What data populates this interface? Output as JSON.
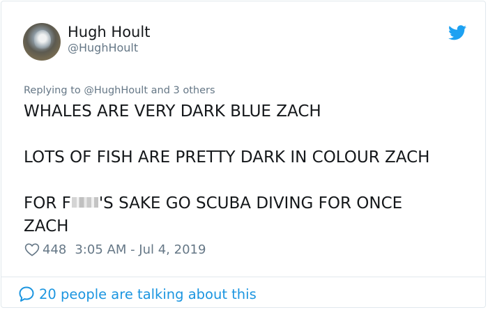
{
  "author": {
    "display_name": "Hugh Hoult",
    "handle": "@HughHoult"
  },
  "icons": {
    "platform": "twitter-bird-icon",
    "like": "heart-icon",
    "conversation": "speech-bubble-icon"
  },
  "reply_context": "Replying to @HughHoult and 3 others",
  "tweet": {
    "line1": "WHALES ARE VERY DARK BLUE ZACH",
    "line2": "LOTS OF FISH ARE PRETTY DARK IN COLOUR ZACH",
    "line3_start": "FOR F",
    "line3_end": "'S SAKE GO SCUBA DIVING FOR ONCE",
    "line4": "ZACH"
  },
  "meta": {
    "like_count": "448",
    "timestamp": "3:05 AM - Jul 4, 2019"
  },
  "footer": {
    "talking_text": "20 people are talking about this"
  },
  "colors": {
    "twitter_blue": "#1da1f2",
    "link_blue": "#1b95e0",
    "secondary_gray": "#657786",
    "text_dark": "#14171a",
    "border": "#e1e8ed"
  }
}
